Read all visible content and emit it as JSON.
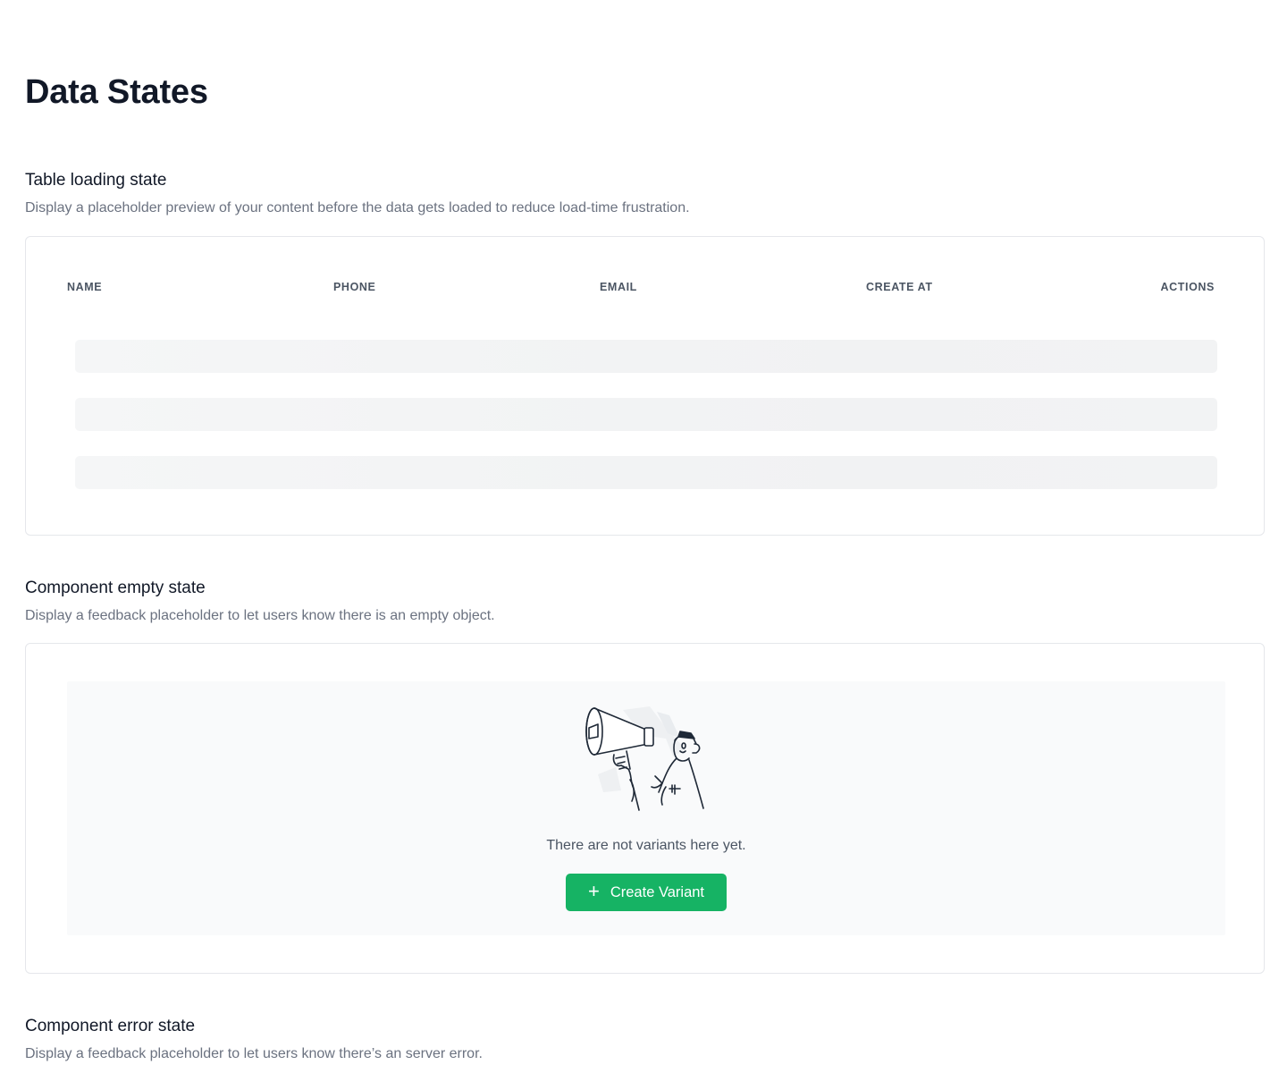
{
  "page": {
    "title": "Data States"
  },
  "loading_section": {
    "title": "Table loading state",
    "description": "Display a placeholder preview of your content before the data gets loaded to reduce load-time frustration.",
    "columns": [
      "NAME",
      "PHONE",
      "EMAIL",
      "CREATE AT",
      "ACTIONS"
    ],
    "skeleton_rows": 3
  },
  "empty_section": {
    "title": "Component empty state",
    "description": "Display a feedback placeholder to let users know there is an empty object.",
    "illustration": "man-with-megaphone-illustration",
    "message": "There are not variants here yet.",
    "button": {
      "icon": "plus-icon",
      "label": "Create Variant"
    }
  },
  "error_section": {
    "title": "Component error state",
    "description": "Display a feedback placeholder to let users know there’s an server error."
  },
  "colors": {
    "accent": "#16b364",
    "text_primary": "#111827",
    "text_secondary": "#6b7280",
    "border": "#e5e7eb",
    "skeleton": "#f3f4f5",
    "panel_bg": "#f9fafb"
  }
}
